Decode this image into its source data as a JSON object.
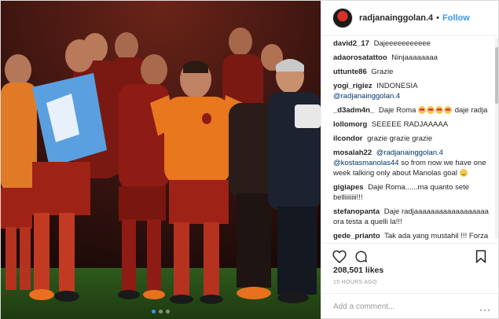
{
  "post": {
    "header": {
      "username": "radjanainggolan.4",
      "separator": "•",
      "follow_label": "Follow",
      "avatar_icon": "avatar-image"
    },
    "photo": {
      "description_icon": "team-celebration-photo",
      "carousel_dots": 3,
      "active_dot": 1
    },
    "comments": [
      {
        "user": "david2_17",
        "text": "Dajeeeeeeeeeee"
      },
      {
        "user": "adaorosatattoo",
        "text": "Ninjaaaaaaaa"
      },
      {
        "user": "uttunte86",
        "text": "Grazie"
      },
      {
        "user": "yogi_rigiez",
        "text": "INDONESIA",
        "mention": "@radjanainggolan.4"
      },
      {
        "user": "_d3adm4n_",
        "text": "Daje Roma",
        "text_after": "daje radja",
        "emoji_count": 4
      },
      {
        "user": "lollomorg",
        "text": "SEEEEE RADJAAAAA"
      },
      {
        "user": "ilcondor",
        "text": "grazie grazie grazie"
      },
      {
        "user": "mosalah22",
        "mention": "@radjanainggolan.4",
        "mention2": "@kostasmanolas44",
        "text": "so from now we have one week talking only about Manolas goal"
      },
      {
        "user": "gigiapes",
        "text": "Daje Roma......ma quanto sete belliiiiiii!!!"
      },
      {
        "user": "stefanopanta",
        "text": "Daje radjaaaaaaaaaaaaaaaaaa ora testa a quelli la!!!"
      },
      {
        "user": "gede_prianto",
        "text": "Tak ada yang mustahil !!! Forza Roma!!!"
      }
    ],
    "actions": {
      "like_icon": "heart-icon",
      "comment_icon": "comment-icon",
      "save_icon": "bookmark-icon"
    },
    "likes_label": "208,501 likes",
    "timestamp": "15 HOURS AGO",
    "add_comment": {
      "placeholder": "Add a comment...",
      "more_icon": "more-options-icon",
      "more_label": "···"
    },
    "colors": {
      "link_blue": "#3897f0",
      "mention_blue": "#003569",
      "roma_red": "#8e1b14",
      "roma_orange": "#e8771e"
    }
  }
}
